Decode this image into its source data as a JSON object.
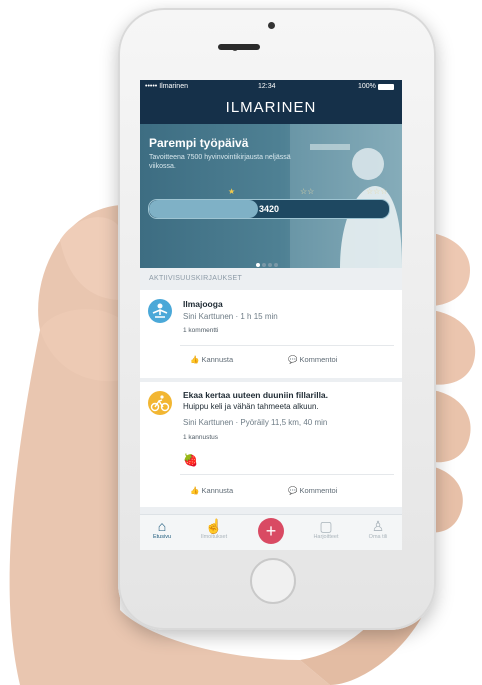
{
  "status_bar": {
    "carrier": "••••• Ilmarinen",
    "time": "12:34",
    "battery": "100%"
  },
  "brand": "ILMARINEN",
  "hero": {
    "title": "Parempi työpäivä",
    "subtitle": "Tavoitteena 7500 hyvinvointikirjausta neljässä viikossa.",
    "progress_value": "3420",
    "progress_fraction": 0.456,
    "stars": [
      "★",
      "☆☆",
      "☆☆☆"
    ],
    "page_count": 4,
    "active_page": 0
  },
  "section_title": "AKTIIVISUUSKIRJAUKSET",
  "posts": [
    {
      "title": "Ilmajooga",
      "meta": "Sini Karttunen · 1 h 15 min",
      "extra": "1 kommentti",
      "avatar_icon": "yoga-icon",
      "avatar_color": "#4aa8d8",
      "like_label": "Kannusta",
      "comment_label": "Kommentoi"
    },
    {
      "title": "Ekaa kertaa uuteen duuniin fillarilla.",
      "title_line2": "Huippu keli ja vähän tahmeeta alkuun.",
      "meta": "Sini Karttunen · Pyöräily 11,5 km, 40 min",
      "extra": "1 kannustus",
      "avatar_icon": "cycling-icon",
      "avatar_color": "#f2b632",
      "like_label": "Kannusta",
      "comment_label": "Kommentoi"
    }
  ],
  "tabs": [
    {
      "label": "Etusivu",
      "icon": "home-icon"
    },
    {
      "label": "Ilmoitukset",
      "icon": "thumbs-up-icon"
    },
    {
      "label": "",
      "icon": "plus-icon"
    },
    {
      "label": "Harjoitteet",
      "icon": "cup-icon"
    },
    {
      "label": "Oma tili",
      "icon": "user-icon"
    }
  ],
  "colors": {
    "navy": "#153049",
    "accent": "#d94a63",
    "teal": "#4f8194"
  }
}
